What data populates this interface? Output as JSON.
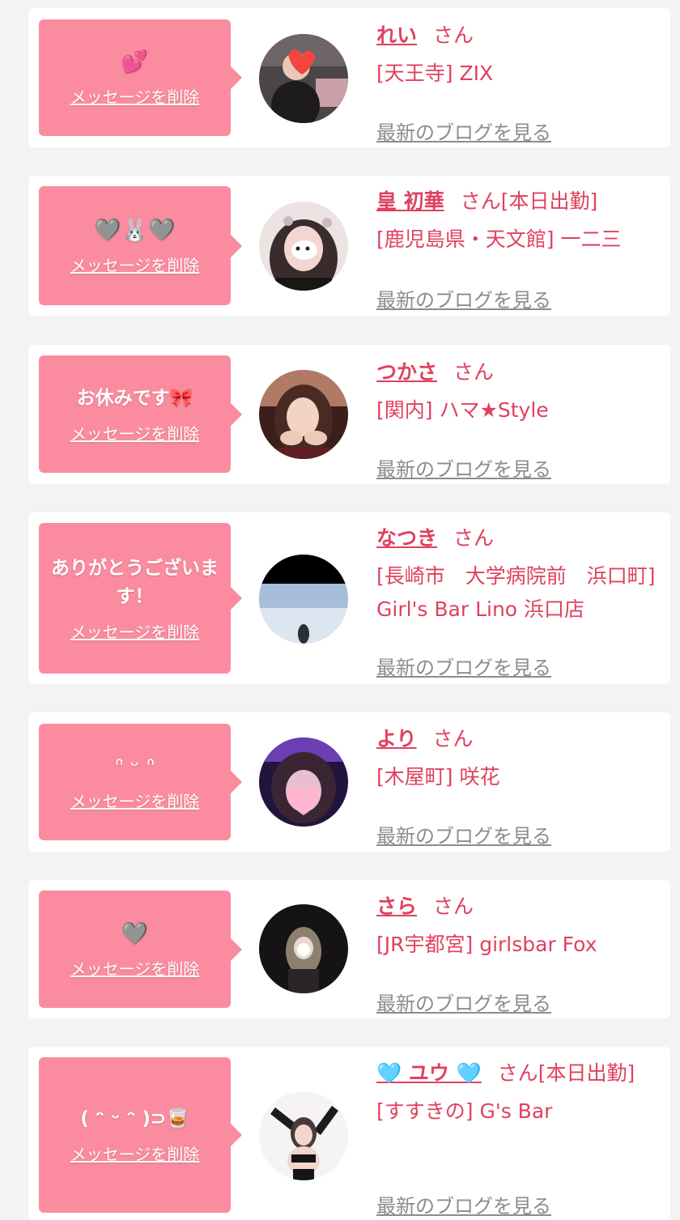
{
  "delete_label": "メッセージを削除",
  "blog_label": "最新のブログを見る",
  "honorific": "さん",
  "cards": [
    {
      "message": "💕",
      "name": "れい",
      "status": "",
      "shop": "[天王寺] ZIX",
      "avatar_icon": "avatar-photo"
    },
    {
      "message": "🩶🐰🩶",
      "name": "皇 初華",
      "status": "[本日出勤]",
      "shop": "[鹿児島県・天文館] 一二三",
      "avatar_icon": "avatar-photo"
    },
    {
      "message": "お休みです🎀",
      "name": "つかさ",
      "status": "",
      "shop": "[関内] ハマ★Style",
      "avatar_icon": "avatar-photo"
    },
    {
      "message": "ありがとうございます！",
      "name": "なつき",
      "status": "",
      "shop": "[長崎市　大学病院前　浜口町] Girl's Bar Lino 浜口店",
      "avatar_icon": "avatar-photo"
    },
    {
      "message": "ᐢ ᵕ ᐢ",
      "name": "より",
      "status": "",
      "shop": "[木屋町] 咲花",
      "avatar_icon": "avatar-photo"
    },
    {
      "message": "🩶",
      "name": "さら",
      "status": "",
      "shop": "[JR宇都宮] girlsbar Fox",
      "avatar_icon": "avatar-photo"
    },
    {
      "message": "( ᵔ ᵕ ᵔ )⊃🥃",
      "name": "🩵 ユウ 🩵",
      "status": "[本日出勤]",
      "shop": "[すすきの] G's Bar",
      "avatar_icon": "avatar-photo"
    }
  ],
  "colors": {
    "page_bg": "#f3f3f3",
    "card_bg": "#ffffff",
    "bubble": "#fb8c9f",
    "accent_text": "#e0415e",
    "link_gray": "#8c8c8c"
  }
}
